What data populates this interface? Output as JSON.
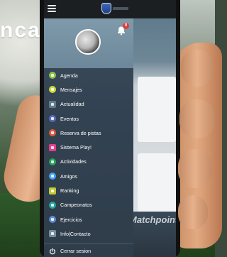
{
  "promo": {
    "headline_fragment": "nca"
  },
  "app": {
    "brand_watermark": "Matchpoint"
  },
  "drawer": {
    "notification_count": "0",
    "items": [
      {
        "label": "Agenda",
        "icon": "calendar-icon",
        "color": "#8bc34a"
      },
      {
        "label": "Mensajes",
        "icon": "message-icon",
        "color": "#cddc39"
      },
      {
        "label": "Actualidad",
        "icon": "news-icon",
        "color": "#607d8b"
      },
      {
        "label": "Eventos",
        "icon": "events-icon",
        "color": "#5c6bc0"
      },
      {
        "label": "Reserva de pistas",
        "icon": "booking-icon",
        "color": "#e25a3a"
      },
      {
        "label": "Sistema Play!",
        "icon": "play-system-icon",
        "color": "#e83e8c"
      },
      {
        "label": "Actividades",
        "icon": "activities-icon",
        "color": "#2aa55a"
      },
      {
        "label": "Amigos",
        "icon": "friends-icon",
        "color": "#42a5f5"
      },
      {
        "label": "Ranking",
        "icon": "ranking-icon",
        "color": "#c0ca33"
      },
      {
        "label": "Campeonatos",
        "icon": "trophy-icon",
        "color": "#26a69a"
      },
      {
        "label": "Ejercicios",
        "icon": "exercise-icon",
        "color": "#5c8dd6"
      },
      {
        "label": "Info|Contacto",
        "icon": "info-icon",
        "color": "#78909c"
      }
    ],
    "logout_label": "Cerrar sesion"
  }
}
